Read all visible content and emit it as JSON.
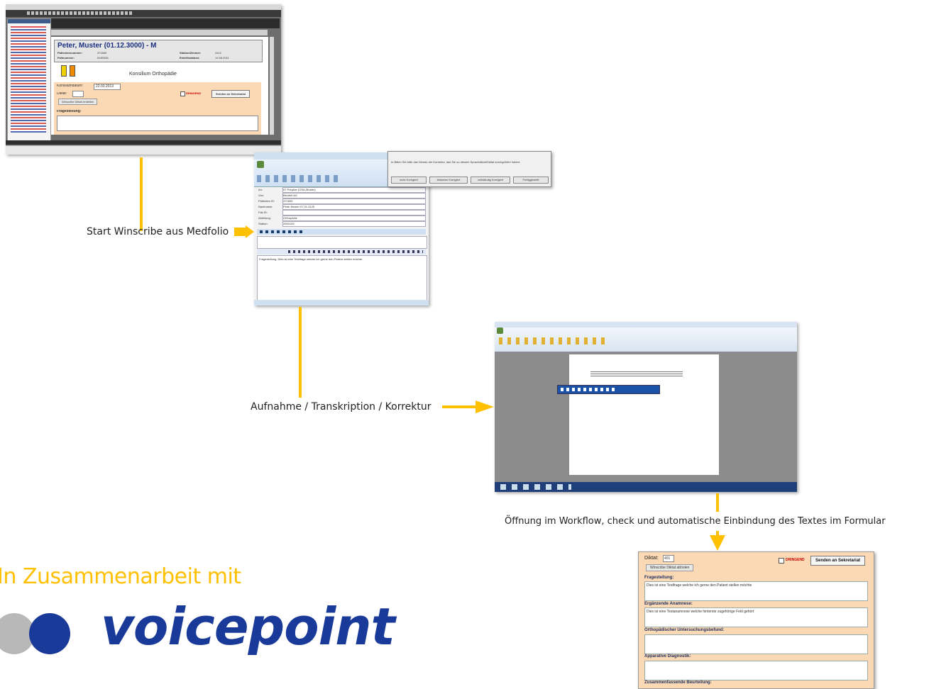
{
  "steps": {
    "step1": "Start Winscribe aus Medfolio",
    "step2": "Aufnahme / Transkription / Korrektur",
    "step3": "Öffnung im Workflow, check und automatische Einbindung des Textes im Formular"
  },
  "branding": {
    "partner_text": "In Zusammenarbeit mit",
    "logo_text": "voicepoint"
  },
  "medfolio": {
    "patient_header": "Peter, Muster (01.12.3000) - M",
    "patientennummer_label": "Patientennummer:",
    "patientennummer": "371669",
    "fallnummer_label": "Fallnummer:",
    "fallnummer": "6180346",
    "station_label": "Station/Zimmer:",
    "station": "4113",
    "eintritt_label": "Eintrittsdatum:",
    "eintritt": "12.08.2011",
    "form_title": "Konsilium Orthopädie",
    "konsiliumdatum_label": "Konsiliumdatum:",
    "konsiliumdatum": "22.03.2013",
    "diktat_label": "Diktat:",
    "winscribe_button": "Winscribe Diktat erstellen",
    "dringend_label": "DRINGEND",
    "send_button": "Senden an Sekretariat",
    "fragestellung_label": "Fragestellung:"
  },
  "winscribe": {
    "dialog_text": "In Bitten Sie bitte das Niveau der Korrektur, das Sie zu diesem Sprachdiktat/Diktat durchgeführt haben:",
    "buttons": [
      "nicht Korrigiert",
      "teilweise Korrigiert",
      "vollständig Korrigiert",
      "Fertiggestellt"
    ],
    "fields": [
      "An:",
      "Von:",
      "Patienten ID:",
      "Nachname:",
      "Fall-ID:",
      "Abteilung:",
      "Station:"
    ],
    "values": [
      "07 Prepbar (OSA-Muster)",
      "Bechtel AG",
      "371669",
      "Peter Muster 07.01.3125",
      "",
      "Orthopädie",
      "2500109"
    ],
    "body_text": "Fragestellung. Dies ist eine Testfrage welche ich gerne den Patient stellen möchte."
  },
  "result_form": {
    "diktat_label": "Diktat:",
    "diktat_value": "401",
    "winscribe_button": "Winscribe Diktat abholen",
    "dringend_label": "DRINGEND",
    "send_button": "Senden an Sekretariat",
    "fragestellung_label": "Fragestellung:",
    "fragestellung_text": "Dies ist eine Testfrage welche ich gerne den Patient stellen möchte",
    "anamnese_label": "Ergänzende Anamnese:",
    "anamnese_text": "Dies ist eine Testanamnese welche hinterste zugehörige Feld gehört",
    "befund_label": "Orthopädischer Untersuchungsbefund:",
    "diagnostik_label": "Apparative Diagnostik:",
    "beurteilung_label": "Zusammenfassende Beurteilung:"
  },
  "colors": {
    "accent": "#ffc000",
    "logo_blue": "#1a3a9a",
    "form_orange": "#fbd9b4"
  }
}
